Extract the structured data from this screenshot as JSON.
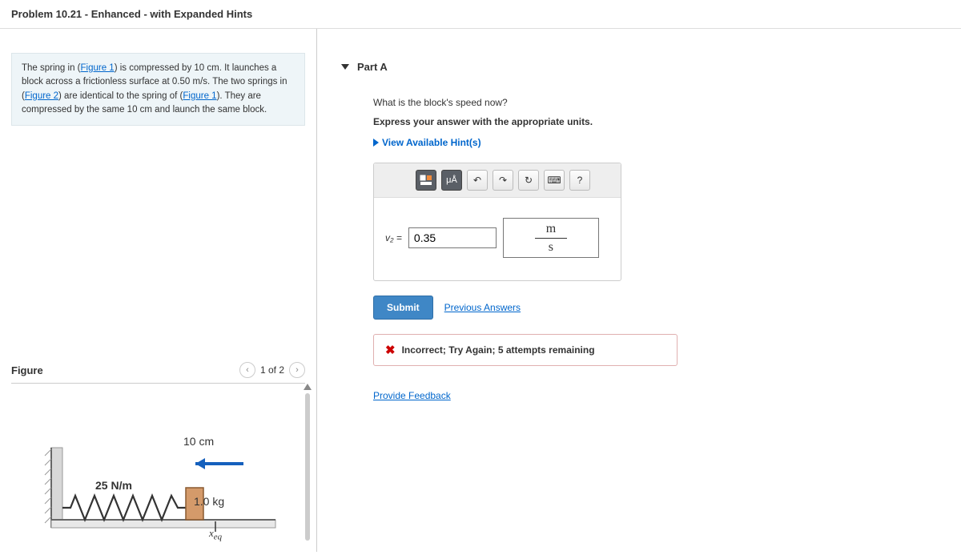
{
  "header": {
    "title": "Problem 10.21 - Enhanced - with Expanded Hints"
  },
  "prompt": {
    "t1": "The spring in (",
    "link1": "Figure 1",
    "t2": ") is compressed by 10 cm. It launches a block across a frictionless surface at 0.50 m/s. The two springs in (",
    "link2": "Figure 2",
    "t3": ") are identical to the spring of (",
    "link3": "Figure 1",
    "t4": "). They are compressed by the same 10 cm and launch the same block."
  },
  "figure": {
    "label": "Figure",
    "pager": "1 of 2",
    "dim_label": "10 cm",
    "spring_k": "25 N/m",
    "mass": "1.0 kg",
    "xeq": "x",
    "xeq_sub": "eq"
  },
  "part": {
    "label": "Part A",
    "question": "What is the block's speed now?",
    "instruction": "Express your answer with the appropriate units.",
    "hints_label": "View Available Hint(s)",
    "toolbar": {
      "tpl": "□",
      "mu": "μÅ",
      "undo": "↶",
      "redo": "↷",
      "reset": "↻",
      "kbd": "⌨",
      "help": "?"
    },
    "var_label": "v₂ =",
    "value": "0.35",
    "unit_top": "m",
    "unit_bot": "s",
    "submit": "Submit",
    "prev": "Previous Answers",
    "feedback": "Incorrect; Try Again; 5 attempts remaining",
    "provide_feedback": "Provide Feedback"
  }
}
